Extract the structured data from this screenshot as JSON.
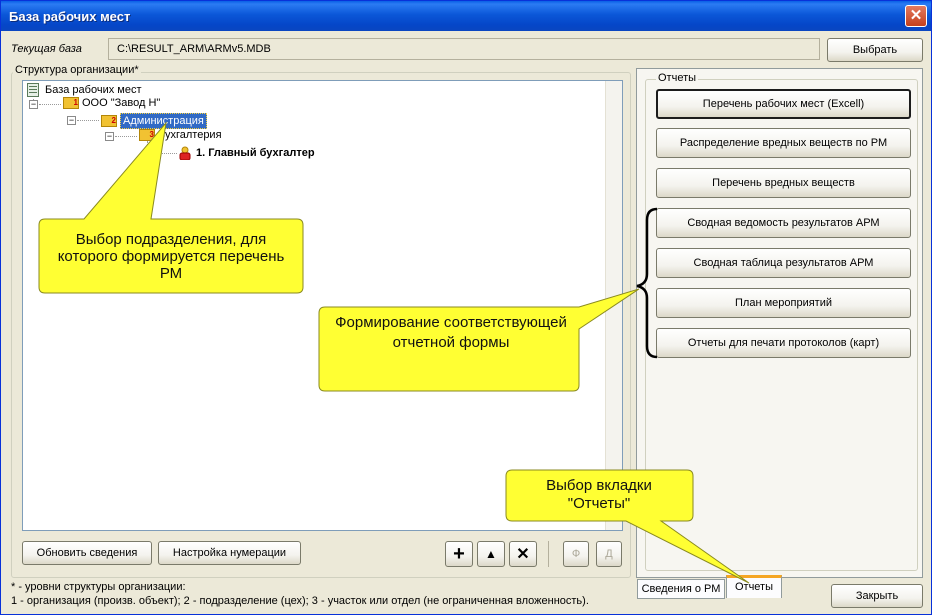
{
  "window": {
    "title": "База рабочих мест",
    "close_glyph": "✕"
  },
  "current_db": {
    "label": "Текущая база",
    "path": "C:\\RESULT_ARM\\ARMv5.MDB",
    "choose_label": "Выбрать"
  },
  "structure": {
    "title": "Структура организации*",
    "root": "База рабочих мест",
    "nodes": {
      "org": {
        "level": "1",
        "label": "ООО \"Завод Н\""
      },
      "dept": {
        "level": "2",
        "label": "Администрация"
      },
      "sub": {
        "level": "3",
        "label": "Бухгалтерия"
      },
      "post": {
        "label": "1. Главный бухгалтер"
      }
    },
    "expander_glyph": "−"
  },
  "toolbar": {
    "refresh_label": "Обновить сведения",
    "numbering_label": "Настройка нумерации",
    "add_glyph": "+",
    "up_glyph": "▲",
    "delete_glyph": "✕",
    "f_label": "Ф",
    "d_label": "Д"
  },
  "reports": {
    "title": "Отчеты",
    "buttons": [
      "Перечень рабочих мест (Excell)",
      "Распределение вредных веществ по РМ",
      "Перечень вредных веществ",
      "Сводная ведомость результатов АРМ",
      "Сводная таблица результатов АРМ",
      "План мероприятий",
      "Отчеты для печати протоколов (карт)"
    ]
  },
  "tabs": {
    "info": "Сведения о РМ",
    "reports": "Отчеты"
  },
  "callouts": {
    "select_dept": "Выбор подразделения, для которого формируется перечень РМ",
    "form_report": "Формирование соответствующей отчетной формы",
    "select_tab": "Выбор вкладки \"Отчеты\""
  },
  "footnote": {
    "line1": "* - уровни структуры организации:",
    "line2": "1 - организация (произв. объект); 2 - подразделение (цех); 3 - участок или отдел (не ограниченная вложенность)."
  },
  "close_button": "Закрыть",
  "colors": {
    "title_blue": "#0b57d8",
    "selection": "#316ac5",
    "callout_yellow": "#ffff33",
    "callout_border": "#8a8a20"
  }
}
